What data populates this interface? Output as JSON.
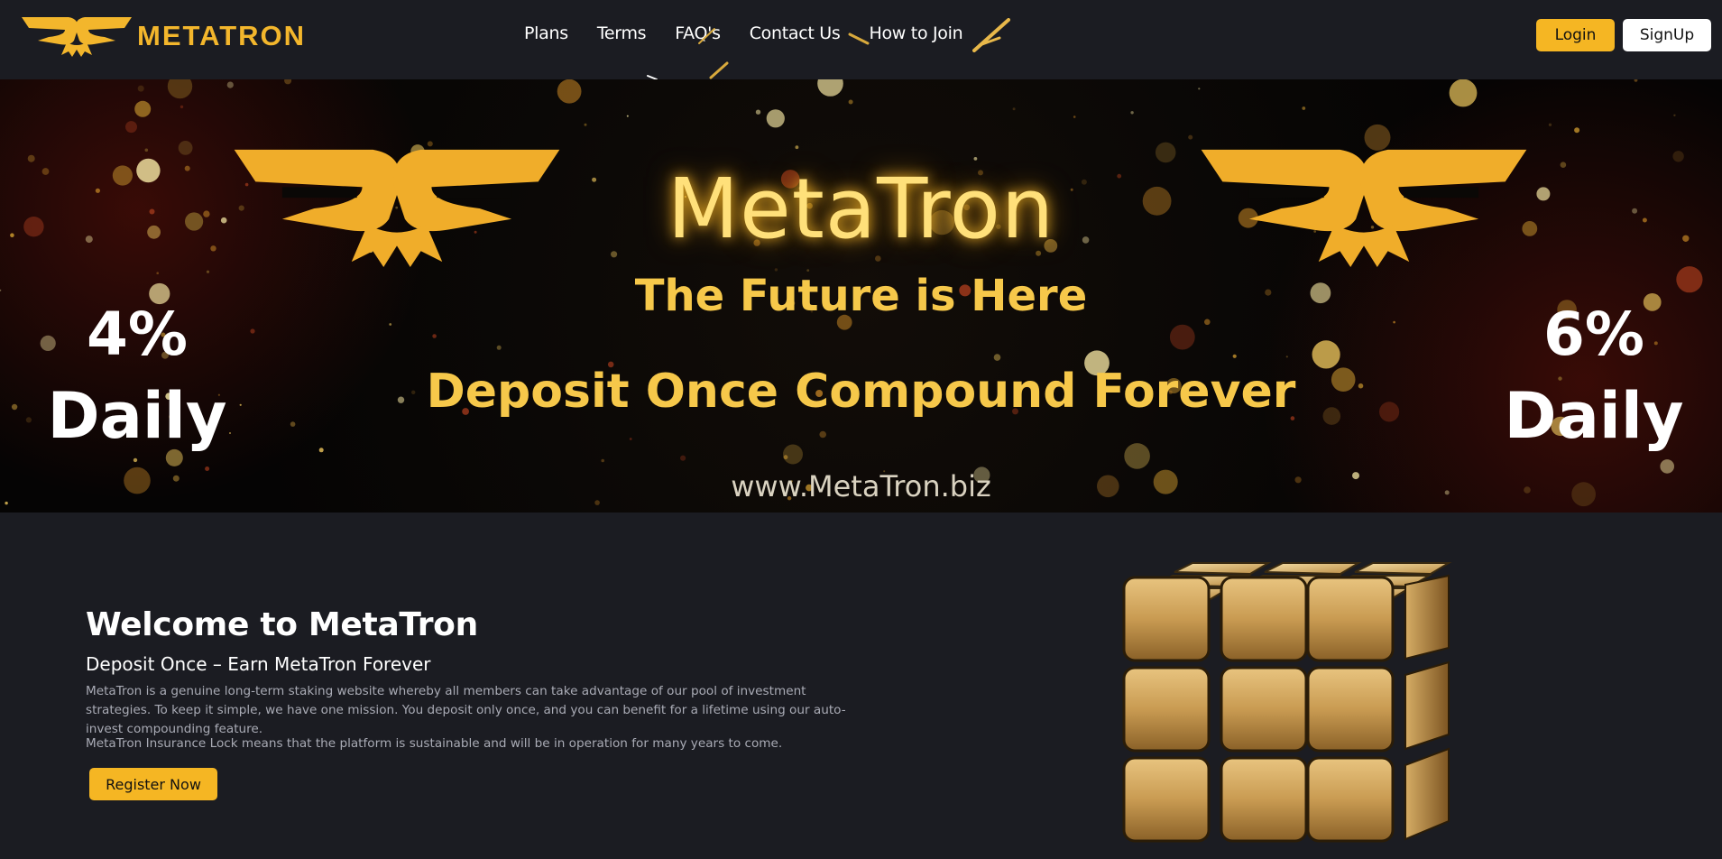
{
  "brand": {
    "name": "METATRON"
  },
  "nav": {
    "items": [
      {
        "label": "Plans"
      },
      {
        "label": "Terms"
      },
      {
        "label": "FAQ's"
      },
      {
        "label": "Contact Us"
      },
      {
        "label": "How to Join"
      }
    ]
  },
  "auth": {
    "login_label": "Login",
    "signup_label": "SignUp"
  },
  "banner": {
    "title": "MetaTron",
    "tagline": "The Future is Here",
    "headline": "Deposit Once Compound Forever",
    "url": "www.MetaTron.biz",
    "left_rate": "4%",
    "left_period": "Daily",
    "right_rate": "6%",
    "right_period": "Daily"
  },
  "welcome": {
    "title": "Welcome to MetaTron",
    "subtitle": "Deposit Once – Earn MetaTron Forever",
    "paragraph1": "MetaTron is a genuine long-term staking website whereby all members can take advantage of our pool of investment strategies. To keep it simple, we have one mission. You deposit only once, and you can benefit for a lifetime using our auto-invest compounding feature.",
    "paragraph2": "MetaTron Insurance Lock means that the platform is sustainable and will be in operation for many years to come.",
    "cta_label": "Register Now"
  },
  "colors": {
    "accent": "#f5b623",
    "background": "#1b1c22",
    "muted_text": "#a9abb5"
  },
  "icons": {
    "logo": "winged-emblem-icon",
    "cube": "gold-cube-icon"
  }
}
